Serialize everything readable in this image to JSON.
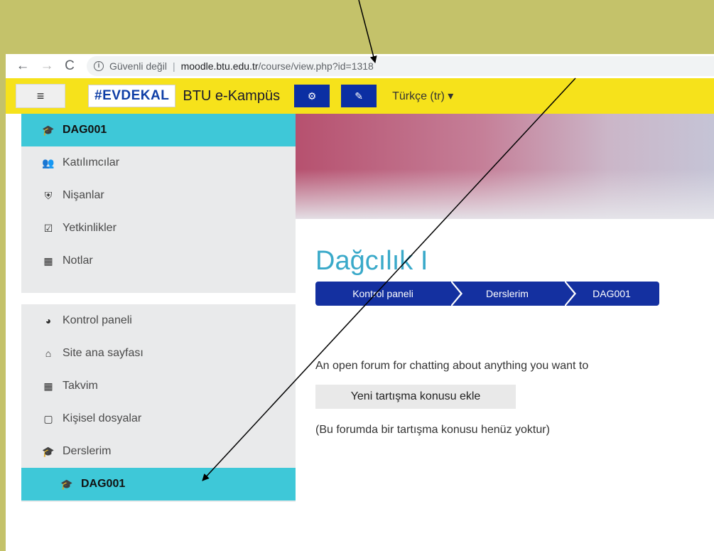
{
  "browser": {
    "back_glyph": "←",
    "forward_glyph": "→",
    "reload_glyph": "C",
    "info_glyph": "i",
    "security_text": "Güvenli değil",
    "separator": "|",
    "url_domain": "moodle.btu.edu.tr",
    "url_path": "/course/view.php?id=1318"
  },
  "navbar": {
    "menu_glyph": "≡",
    "brand_logo": "#EVDEKAL",
    "brand_name": "BTU e-Kampüs",
    "settings_glyph": "⚙",
    "edit_glyph": "✎",
    "language": "Türkçe (tr) ▾"
  },
  "sidebar": {
    "course_block": [
      {
        "icon": "graduation-cap-icon",
        "glyph": "🎓",
        "label": "DAG001",
        "active": true
      },
      {
        "icon": "users-icon",
        "glyph": "👥",
        "label": "Katılımcılar"
      },
      {
        "icon": "shield-icon",
        "glyph": "⛨",
        "label": "Nişanlar"
      },
      {
        "icon": "check-square-icon",
        "glyph": "☑",
        "label": "Yetkinlikler"
      },
      {
        "icon": "table-icon",
        "glyph": "▦",
        "label": "Notlar"
      }
    ],
    "site_block": [
      {
        "icon": "dashboard-icon",
        "glyph": "◕",
        "label": "Kontrol paneli"
      },
      {
        "icon": "home-icon",
        "glyph": "⌂",
        "label": "Site ana sayfası"
      },
      {
        "icon": "calendar-icon",
        "glyph": "▦",
        "label": "Takvim"
      },
      {
        "icon": "file-icon",
        "glyph": "▢",
        "label": "Kişisel dosyalar"
      },
      {
        "icon": "graduation-cap-icon",
        "glyph": "🎓",
        "label": "Derslerim"
      },
      {
        "icon": "graduation-cap-icon",
        "glyph": "🎓",
        "label": "DAG001",
        "active": true
      }
    ]
  },
  "main": {
    "course_title": "Dağcılık I",
    "breadcrumb": [
      "Kontrol paneli",
      "Derslerim",
      "DAG001"
    ],
    "forum_intro": "An open forum for chatting about anything you want to",
    "new_topic_button": "Yeni tartışma konusu ekle",
    "no_topics_text": "(Bu forumda bir tartışma konusu henüz yoktur)"
  },
  "colors": {
    "slide_background": "#c4c26a",
    "navbar": "#f6e21b",
    "nav_buttons": "#0b2fa3",
    "active_item": "#3ec8d8",
    "breadcrumb": "#1430a0",
    "course_title": "#39a9c9"
  }
}
